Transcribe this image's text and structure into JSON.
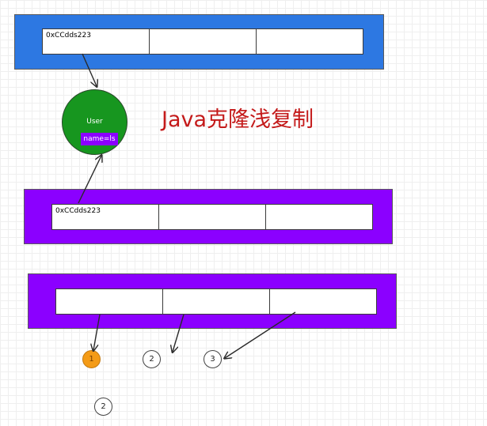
{
  "title": "Java克隆浅复制",
  "top_array": {
    "cells": [
      "0xCCdds223",
      "",
      ""
    ],
    "color": "#2d78e2"
  },
  "user_object": {
    "label": "User",
    "field": "name=ls",
    "color": "#17961f",
    "field_color": "#8b00ff"
  },
  "middle_array": {
    "cells": [
      "0xCCdds223",
      "",
      ""
    ],
    "color": "#8b00ff"
  },
  "bottom_array": {
    "cells": [
      "",
      "",
      ""
    ],
    "color": "#8b00ff"
  },
  "nodes": [
    {
      "label": "1",
      "color": "#f49b16"
    },
    {
      "label": "2",
      "color": "#ffffff"
    },
    {
      "label": "3",
      "color": "#ffffff"
    },
    {
      "label": "2",
      "color": "#ffffff"
    }
  ]
}
